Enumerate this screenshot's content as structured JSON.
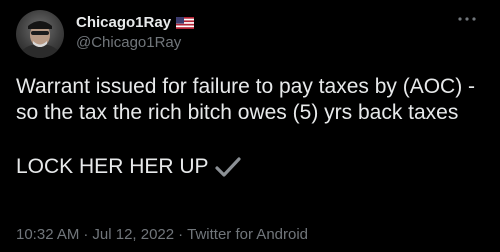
{
  "author": {
    "display_name": "Chicago1Ray",
    "handle": "@Chicago1Ray",
    "flag_icon": "us-flag-icon"
  },
  "tweet": {
    "paragraph_1": "Warrant issued for failure to pay taxes by (AOC) - so the tax the rich bitch owes (5) yrs back taxes",
    "paragraph_2": "LOCK HER HER UP",
    "check_icon": "heavy-check-mark-icon"
  },
  "meta": {
    "time": "10:32 AM",
    "date": "Jul 12, 2022",
    "source": "Twitter for Android",
    "separator": "·"
  },
  "colors": {
    "background": "#000000",
    "text_primary": "#e7e9ea",
    "text_secondary": "#71767b"
  }
}
